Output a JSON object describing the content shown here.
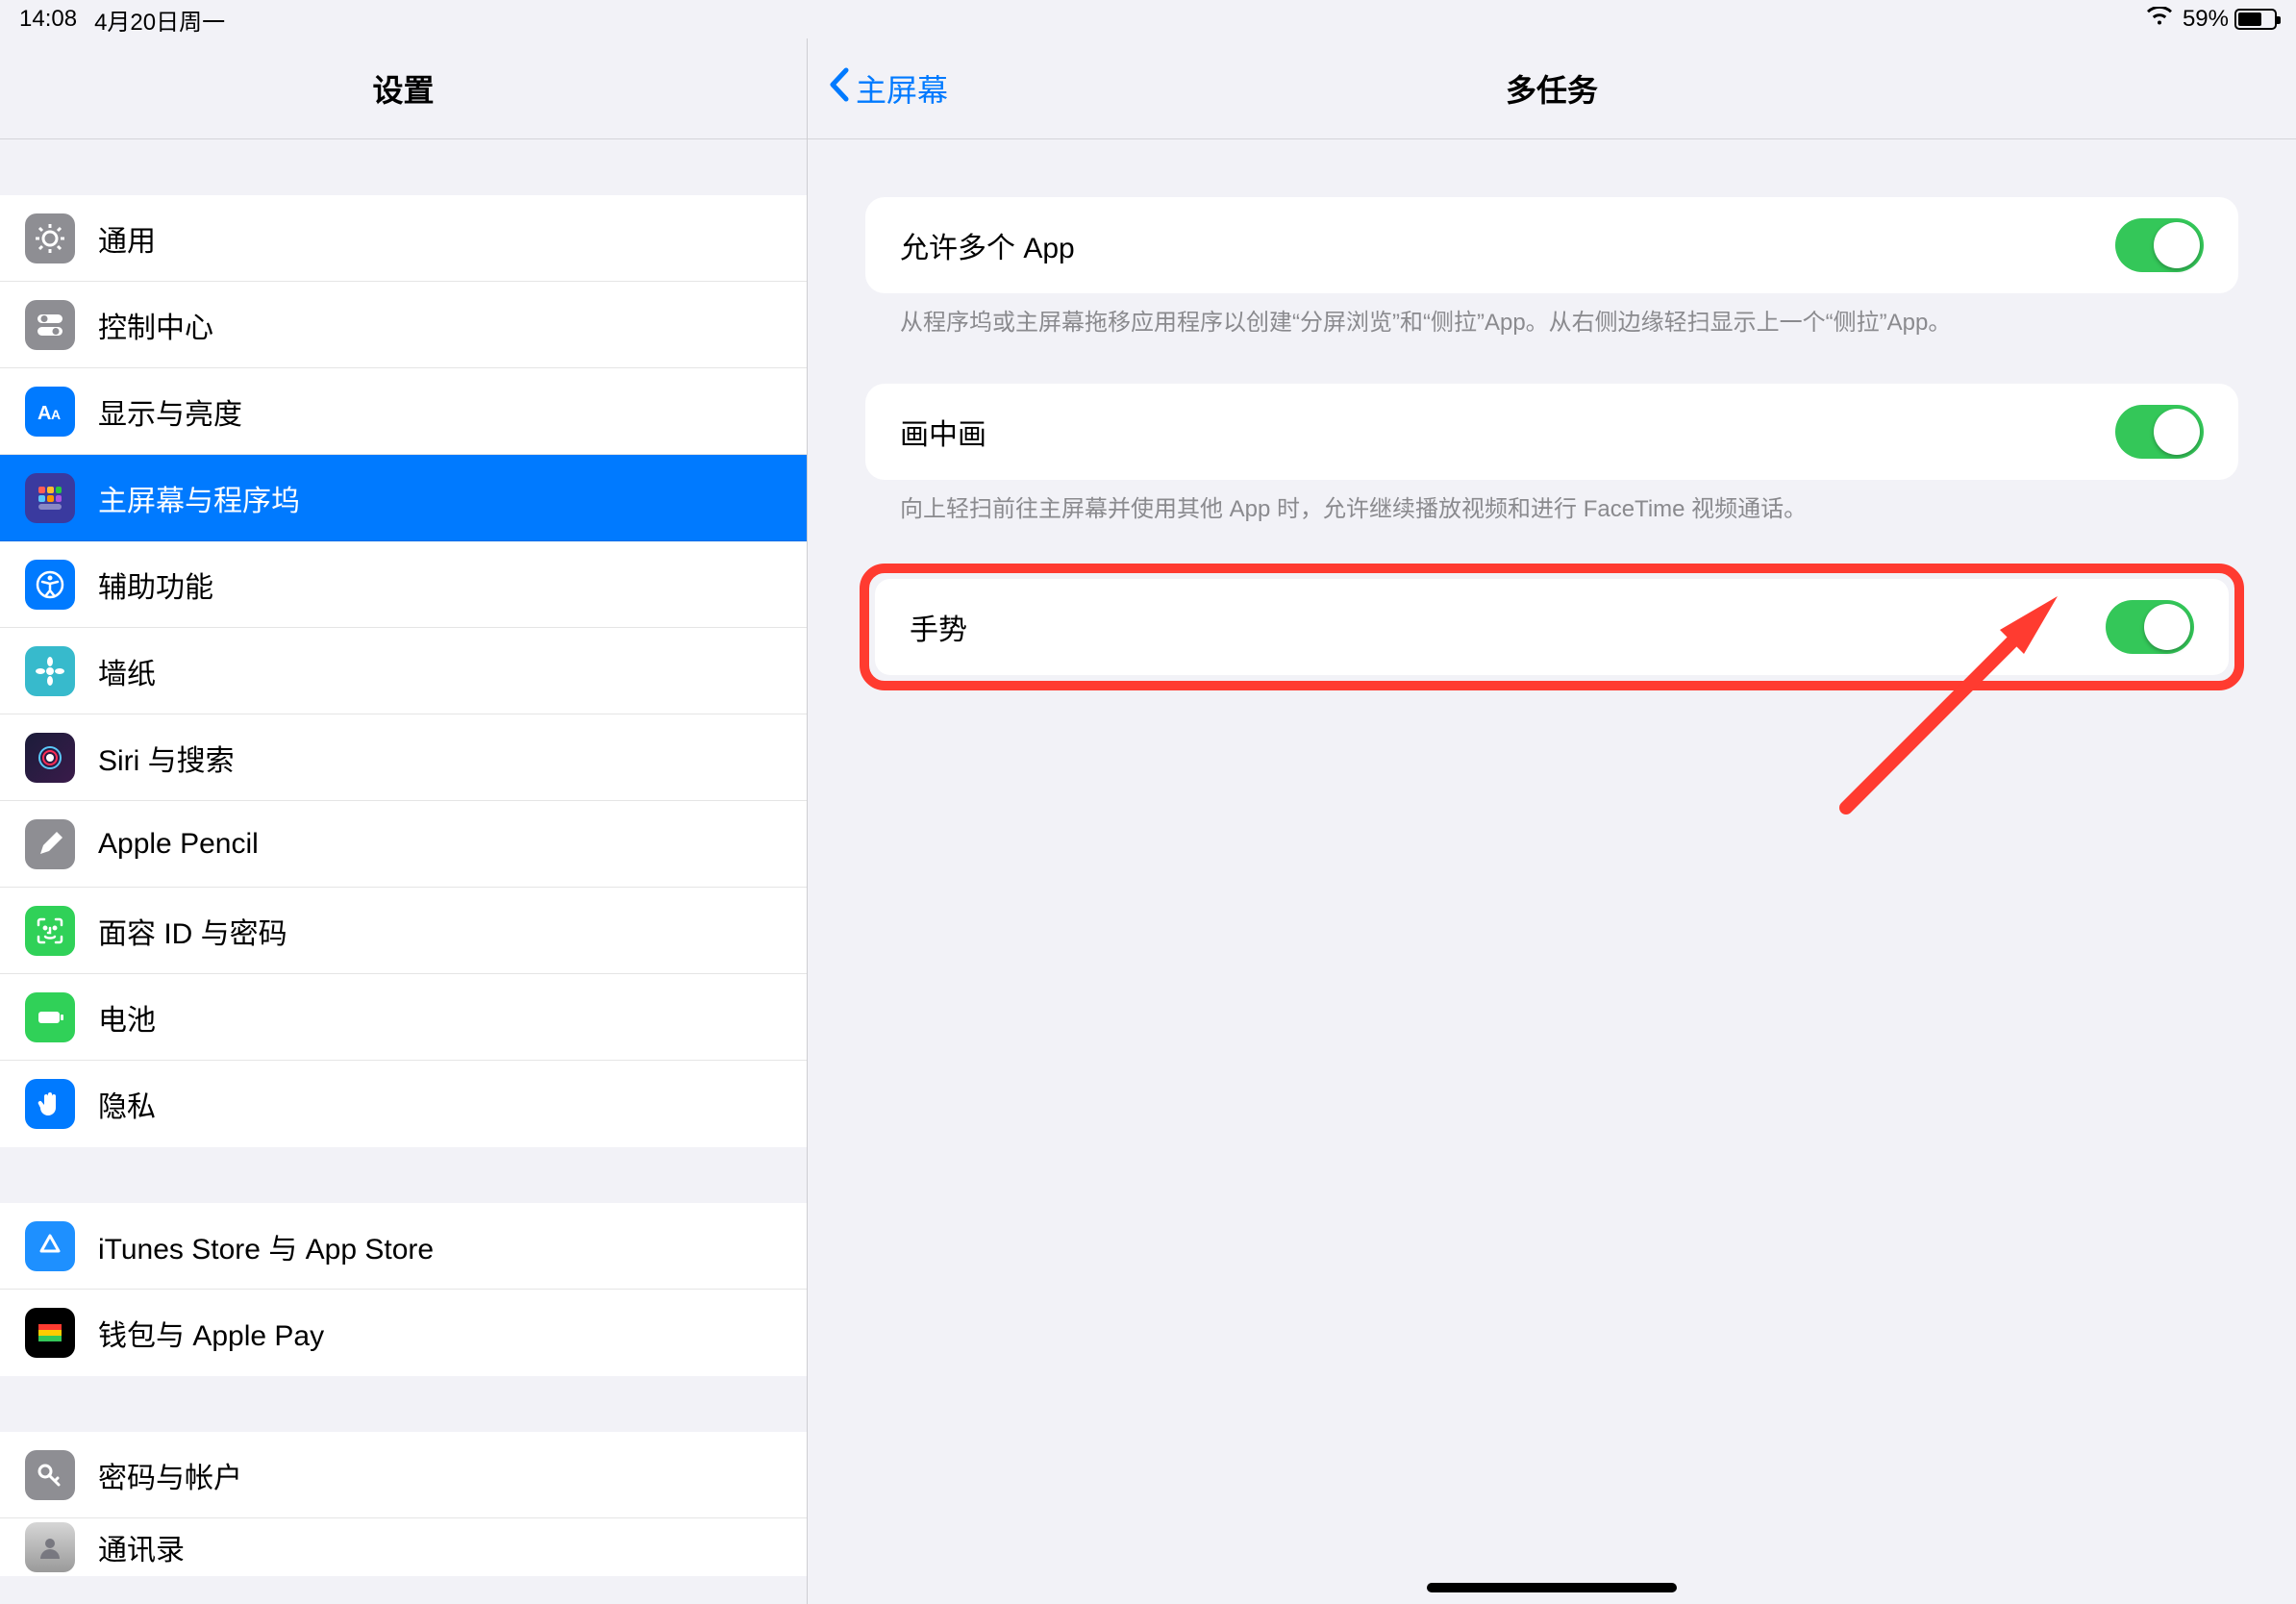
{
  "status": {
    "time": "14:08",
    "date": "4月20日周一",
    "battery_pct": "59%"
  },
  "sidebar": {
    "title": "设置",
    "groups": [
      {
        "items": [
          {
            "key": "general",
            "label": "通用"
          },
          {
            "key": "control",
            "label": "控制中心"
          },
          {
            "key": "display",
            "label": "显示与亮度"
          },
          {
            "key": "home",
            "label": "主屏幕与程序坞",
            "selected": true
          },
          {
            "key": "accessibility",
            "label": "辅助功能"
          },
          {
            "key": "wallpaper",
            "label": "墙纸"
          },
          {
            "key": "siri",
            "label": "Siri 与搜索"
          },
          {
            "key": "pencil",
            "label": "Apple Pencil"
          },
          {
            "key": "faceid",
            "label": "面容 ID 与密码"
          },
          {
            "key": "battery",
            "label": "电池"
          },
          {
            "key": "privacy",
            "label": "隐私"
          }
        ]
      },
      {
        "items": [
          {
            "key": "itunes",
            "label": "iTunes Store 与 App Store"
          },
          {
            "key": "wallet",
            "label": "钱包与 Apple Pay"
          }
        ]
      },
      {
        "items": [
          {
            "key": "passwords",
            "label": "密码与帐户"
          },
          {
            "key": "contacts",
            "label": "通讯录",
            "partial": true
          }
        ]
      }
    ]
  },
  "detail": {
    "back_label": "主屏幕",
    "title": "多任务",
    "settings": [
      {
        "key": "allow_multiple_apps",
        "label": "允许多个 App",
        "on": true,
        "desc": "从程序坞或主屏幕拖移应用程序以创建“分屏浏览”和“侧拉”App。从右侧边缘轻扫显示上一个“侧拉”App。"
      },
      {
        "key": "picture_in_picture",
        "label": "画中画",
        "on": true,
        "desc": "向上轻扫前往主屏幕并使用其他 App 时，允许继续播放视频和进行 FaceTime 视频通话。"
      },
      {
        "key": "gestures",
        "label": "手势",
        "on": true,
        "highlighted": true
      }
    ]
  }
}
